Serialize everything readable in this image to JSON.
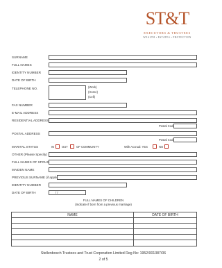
{
  "logo": {
    "mark": "ST&T",
    "line1": "EXECUTORS & TRUSTEES",
    "line2": "WEALTH • ESTATES • PROTECTION"
  },
  "fields": {
    "surname": "SURNAME",
    "full_names": "FULL NAMES",
    "identity_number": "IDENTITY NUMBER",
    "date_of_birth": "DATE OF BIRTH",
    "telephone_no": "TELEPHONE NO.",
    "work": "(Work)",
    "home": "(Home)",
    "cell": "(Cell)",
    "fax_number": "FAX NUMBER",
    "email": "E-MAIL ADDRESS",
    "residential_address": "RESIDENTIAL ADDRESS",
    "postal_code_1": "Postal Code",
    "postal_address": "POSTAL ADDRESS",
    "postal_code_2": "Postal Code",
    "marital_status": "MARITAL STATUS",
    "in": "IN",
    "out": "OUT",
    "of_community": "OF COMMUNITY",
    "with_accrual": "With Accrual:  YES",
    "no": "NO",
    "other": "OTHER (Please Specify)",
    "spouse_names": "FULL NAMES OF SPOUSE",
    "maiden_name": "MAIDEN NAME",
    "previous_surname": "PREVIOUS SURNAME (if applicable)",
    "identity_number_2": "IDENTITY NUMBER",
    "date_of_birth_2": "DATE OF BIRTH",
    "dob_slashes": "/          /"
  },
  "children": {
    "title": "FULL NAMES OF CHILDREN",
    "subtitle": "(Indicate if born from a previous marriage)",
    "col_name": "NAME",
    "col_dob": "DATE OF BIRTH",
    "rows": 5
  },
  "footer": {
    "company": "Stellenbosch Trustees and Trust Corporation Limited Reg No: 1952/001387/06",
    "page": "2  of 5"
  }
}
